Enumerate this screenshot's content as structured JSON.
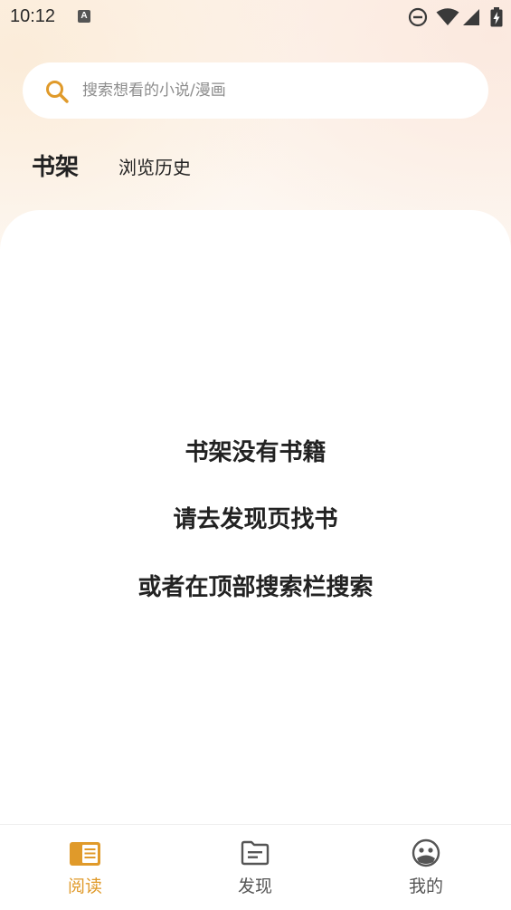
{
  "status_bar": {
    "time": "10:12",
    "notification_icon_letter": "A",
    "icons": [
      "do-not-disturb-icon",
      "wifi-icon",
      "cell-signal-icon",
      "battery-charging-icon"
    ]
  },
  "search": {
    "placeholder": "搜索想看的小说/漫画",
    "icon": "search-icon"
  },
  "tabs": [
    {
      "label": "书架",
      "active": true
    },
    {
      "label": "浏览历史",
      "active": false
    }
  ],
  "empty_state": {
    "line1": "书架没有书籍",
    "line2": "请去发现页找书",
    "line3": "或者在顶部搜索栏搜索"
  },
  "bottom_nav": {
    "items": [
      {
        "label": "阅读",
        "icon": "book-reading-icon",
        "active": true
      },
      {
        "label": "发现",
        "icon": "folder-discover-icon",
        "active": false
      },
      {
        "label": "我的",
        "icon": "profile-face-icon",
        "active": false
      }
    ]
  },
  "colors": {
    "accent": "#e09a2a",
    "text_primary": "#222222",
    "text_secondary": "#8c8c8c",
    "nav_inactive": "#555555",
    "background_tint": "#fdf3ea"
  }
}
